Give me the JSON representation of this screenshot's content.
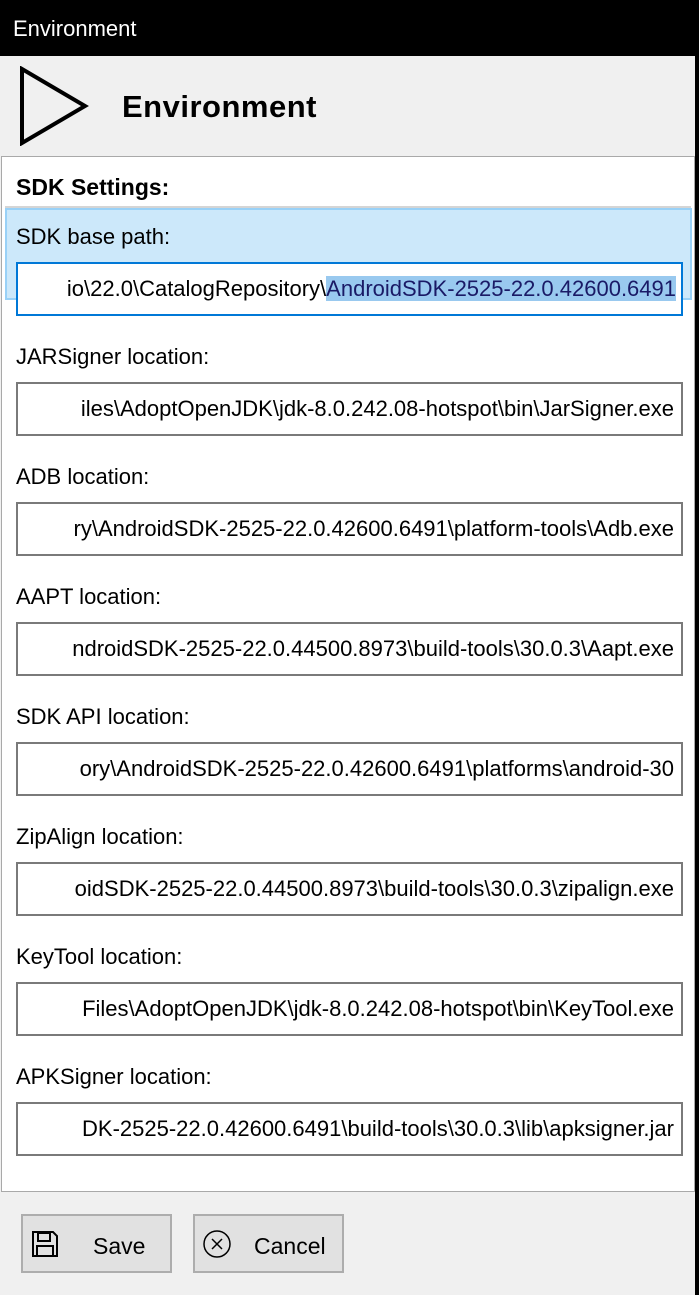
{
  "window": {
    "title": "Environment"
  },
  "header": {
    "title": "Environment",
    "icon": "play-icon"
  },
  "sdk": {
    "group_title": "SDK Settings:",
    "fields": [
      {
        "label": "SDK base path:",
        "value_plain": "io\\22.0\\CatalogRepository\\",
        "value_selected": "AndroidSDK-2525-22.0.42600.6491"
      },
      {
        "label": "JARSigner location:",
        "value": "iles\\AdoptOpenJDK\\jdk-8.0.242.08-hotspot\\bin\\JarSigner.exe"
      },
      {
        "label": "ADB location:",
        "value": "ry\\AndroidSDK-2525-22.0.42600.6491\\platform-tools\\Adb.exe"
      },
      {
        "label": "AAPT location:",
        "value": "ndroidSDK-2525-22.0.44500.8973\\build-tools\\30.0.3\\Aapt.exe"
      },
      {
        "label": "SDK API location:",
        "value": "ory\\AndroidSDK-2525-22.0.42600.6491\\platforms\\android-30"
      },
      {
        "label": "ZipAlign location:",
        "value": "oidSDK-2525-22.0.44500.8973\\build-tools\\30.0.3\\zipalign.exe"
      },
      {
        "label": "KeyTool location:",
        "value": "Files\\AdoptOpenJDK\\jdk-8.0.242.08-hotspot\\bin\\KeyTool.exe"
      },
      {
        "label": "APKSigner location:",
        "value": "DK-2525-22.0.42600.6491\\build-tools\\30.0.3\\lib\\apksigner.jar"
      }
    ]
  },
  "footer": {
    "save_label": "Save",
    "save_icon": "floppy-disk-icon",
    "cancel_label": "Cancel",
    "cancel_icon": "circle-x-icon"
  },
  "colors": {
    "titlebar": "#000000",
    "selection_background": "#cce8fa",
    "focus_border": "#0078d7",
    "text_selection": "#99c9ef"
  }
}
